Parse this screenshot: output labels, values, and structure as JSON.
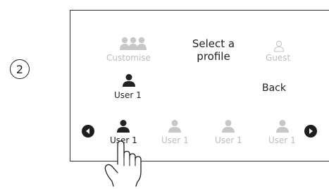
{
  "step": {
    "number": "2"
  },
  "screen": {
    "title": "Select a profile",
    "top_options": [
      {
        "label": "Customise",
        "icon": "group-icon"
      },
      {
        "label": "Guest",
        "icon": "guest-outline-icon"
      }
    ],
    "current_user": {
      "label": "User 1",
      "icon": "user-icon"
    },
    "back_label": "Back",
    "carousel": {
      "prev_icon": "arrow-left-icon",
      "next_icon": "arrow-right-icon",
      "items": [
        {
          "label": "User 1",
          "selected": true
        },
        {
          "label": "User 1",
          "selected": false
        },
        {
          "label": "User 1",
          "selected": false
        },
        {
          "label": "User 1",
          "selected": false
        }
      ]
    }
  },
  "colors": {
    "dark": "#222222",
    "inactive": "#bdbdbd",
    "button": "#1e1e1e"
  },
  "gesture": {
    "icon": "tap-hand-icon"
  }
}
